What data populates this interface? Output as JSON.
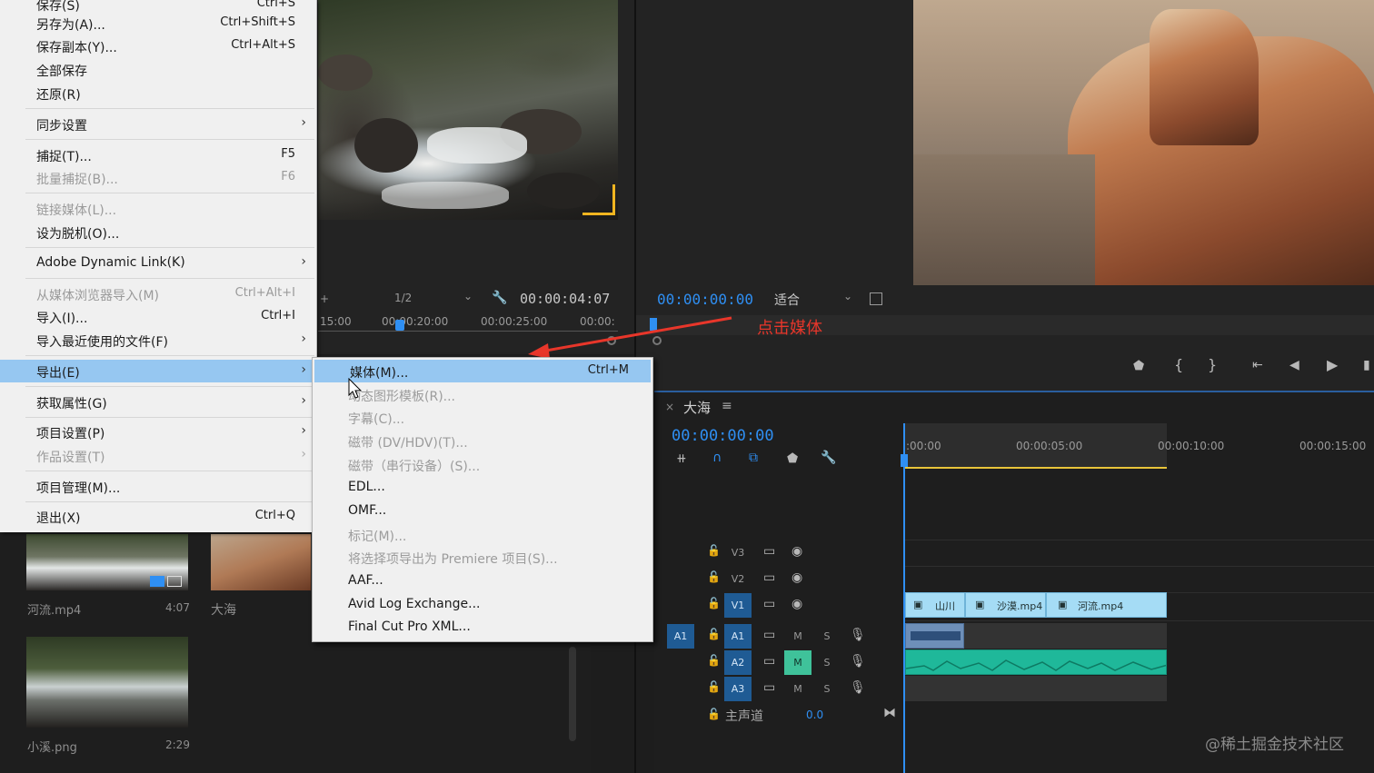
{
  "file_menu": {
    "items": [
      {
        "label": "保存(S)",
        "shortcut": "Ctrl+S",
        "state": "normal"
      },
      {
        "label": "另存为(A)...",
        "shortcut": "Ctrl+Shift+S",
        "state": "normal"
      },
      {
        "label": "保存副本(Y)...",
        "shortcut": "Ctrl+Alt+S",
        "state": "normal"
      },
      {
        "label": "全部保存",
        "shortcut": "",
        "state": "normal"
      },
      {
        "label": "还原(R)",
        "shortcut": "",
        "state": "normal"
      },
      {
        "label": "同步设置",
        "shortcut": "",
        "state": "submenu"
      },
      {
        "label": "捕捉(T)...",
        "shortcut": "F5",
        "state": "normal"
      },
      {
        "label": "批量捕捉(B)...",
        "shortcut": "F6",
        "state": "disabled"
      },
      {
        "label": "链接媒体(L)...",
        "shortcut": "",
        "state": "disabled"
      },
      {
        "label": "设为脱机(O)...",
        "shortcut": "",
        "state": "normal"
      },
      {
        "label": "Adobe Dynamic Link(K)",
        "shortcut": "",
        "state": "submenu"
      },
      {
        "label": "从媒体浏览器导入(M)",
        "shortcut": "Ctrl+Alt+I",
        "state": "disabled"
      },
      {
        "label": "导入(I)...",
        "shortcut": "Ctrl+I",
        "state": "normal"
      },
      {
        "label": "导入最近使用的文件(F)",
        "shortcut": "",
        "state": "submenu"
      },
      {
        "label": "导出(E)",
        "shortcut": "",
        "state": "selected"
      },
      {
        "label": "获取属性(G)",
        "shortcut": "",
        "state": "submenu"
      },
      {
        "label": "项目设置(P)",
        "shortcut": "",
        "state": "submenu"
      },
      {
        "label": "作品设置(T)",
        "shortcut": "",
        "state": "disabled-submenu"
      },
      {
        "label": "项目管理(M)...",
        "shortcut": "",
        "state": "normal"
      },
      {
        "label": "退出(X)",
        "shortcut": "Ctrl+Q",
        "state": "normal"
      }
    ]
  },
  "export_menu": {
    "items": [
      {
        "label": "媒体(M)...",
        "shortcut": "Ctrl+M",
        "state": "selected"
      },
      {
        "label": "动态图形模板(R)...",
        "shortcut": "",
        "state": "disabled"
      },
      {
        "label": "字幕(C)...",
        "shortcut": "",
        "state": "disabled"
      },
      {
        "label": "磁带 (DV/HDV)(T)...",
        "shortcut": "",
        "state": "disabled"
      },
      {
        "label": "磁带（串行设备）(S)...",
        "shortcut": "",
        "state": "disabled"
      },
      {
        "label": "EDL...",
        "shortcut": "",
        "state": "normal"
      },
      {
        "label": "OMF...",
        "shortcut": "",
        "state": "normal"
      },
      {
        "label": "标记(M)...",
        "shortcut": "",
        "state": "disabled"
      },
      {
        "label": "将选择项导出为 Premiere 项目(S)...",
        "shortcut": "",
        "state": "disabled"
      },
      {
        "label": "AAF...",
        "shortcut": "",
        "state": "normal"
      },
      {
        "label": "Avid Log Exchange...",
        "shortcut": "",
        "state": "normal"
      },
      {
        "label": "Final Cut Pro XML...",
        "shortcut": "",
        "state": "normal"
      }
    ]
  },
  "source_monitor": {
    "resolution": "1/2",
    "timecode": "00:00:04:07",
    "ruler_labels": [
      "15:00",
      "00:00:20:00",
      "00:00:25:00",
      "00:00:"
    ]
  },
  "program_monitor": {
    "timecode": "00:00:00:00",
    "fit": "适合",
    "annotation": "点击媒体"
  },
  "timeline": {
    "sequence_name": "大海",
    "timecode": "00:00:00:00",
    "ruler_labels": [
      ":00:00",
      "00:00:05:00",
      "00:00:10:00",
      "00:00:15:00"
    ],
    "video_tracks": [
      "V3",
      "V2",
      "V1"
    ],
    "audio_tracks": [
      "A1",
      "A2",
      "A3"
    ],
    "source_patch": "A1",
    "master_label": "主声道",
    "master_value": "0.0",
    "clips": [
      "山川",
      "沙漠.mp4",
      "河流.mp4"
    ],
    "track_toggle_m": "M",
    "track_toggle_s": "S"
  },
  "project": {
    "items": [
      {
        "name": "河流.mp4",
        "duration": "4:07"
      },
      {
        "name": "大海",
        "duration": ""
      },
      {
        "name": "小溪.png",
        "duration": "2:29"
      }
    ]
  },
  "watermark": "@稀土掘金技术社区",
  "colors": {
    "accent": "#2f8ff3",
    "menu_highlight": "#96c7f1",
    "clip_video": "#a5dcf5",
    "clip_audio": "#1fb89a",
    "annotation": "#e8362a"
  }
}
